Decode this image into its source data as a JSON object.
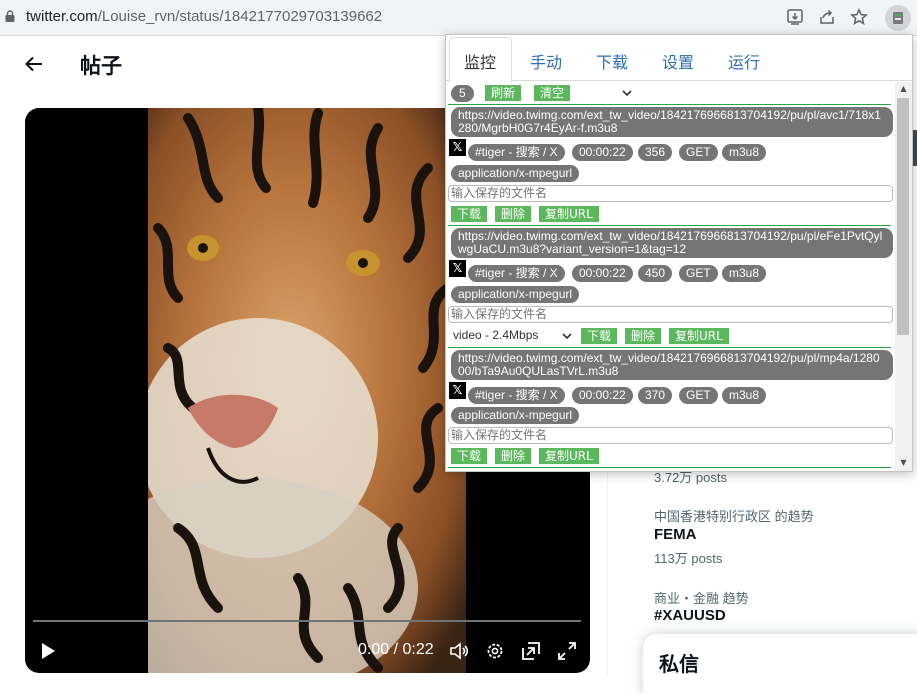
{
  "browser": {
    "url_host": "twitter.com",
    "url_path": "/Louise_rvn/status/1842177029703139662"
  },
  "page": {
    "title": "帖子",
    "video": {
      "time": "0:00 / 0:22",
      "progress": 0
    }
  },
  "trends": [
    {
      "meta": "",
      "topic": "",
      "posts": "3.72万 posts"
    },
    {
      "meta": "中国香港特别行政区 的趋势",
      "topic": "FEMA",
      "posts": "113万 posts"
    },
    {
      "meta": "商业・金融 趋势",
      "topic": "#XAUUSD",
      "posts": ""
    }
  ],
  "dm": {
    "title": "私信"
  },
  "extension": {
    "tabs": [
      "监控",
      "手动",
      "下载",
      "设置",
      "运行"
    ],
    "active_tab": "监控",
    "count": "5",
    "refresh_label": "刷新",
    "clear_label": "清空",
    "filename_placeholder": "输入保存的文件名",
    "download_label": "下载",
    "delete_label": "删除",
    "copy_url_label": "复制URL",
    "items": [
      {
        "url": "https://video.twimg.com/ext_tw_video/1842176966813704192/pu/pl/avc1/718x1280/MgrbH0G7r4EyAr-f.m3u8",
        "tab_title": "#tiger - 搜索 / X",
        "duration": "00:00:22",
        "size": "356",
        "method": "GET",
        "ext": "m3u8",
        "mime": "application/x-mpegurl"
      },
      {
        "url": "https://video.twimg.com/ext_tw_video/1842176966813704192/pu/pl/eFe1PvtQylwgUaCU.m3u8?variant_version=1&tag=12",
        "tab_title": "#tiger - 搜索 / X",
        "duration": "00:00:22",
        "size": "450",
        "method": "GET",
        "ext": "m3u8",
        "mime": "application/x-mpegurl",
        "variant": "video - 2.4Mbps"
      },
      {
        "url": "https://video.twimg.com/ext_tw_video/1842176966813704192/pu/pl/mp4a/128000/bTa9Au0QULasTVrL.m3u8",
        "tab_title": "#tiger - 搜索 / X",
        "duration": "00:00:22",
        "size": "370",
        "method": "GET",
        "ext": "m3u8",
        "mime": "application/x-mpegurl"
      }
    ]
  }
}
